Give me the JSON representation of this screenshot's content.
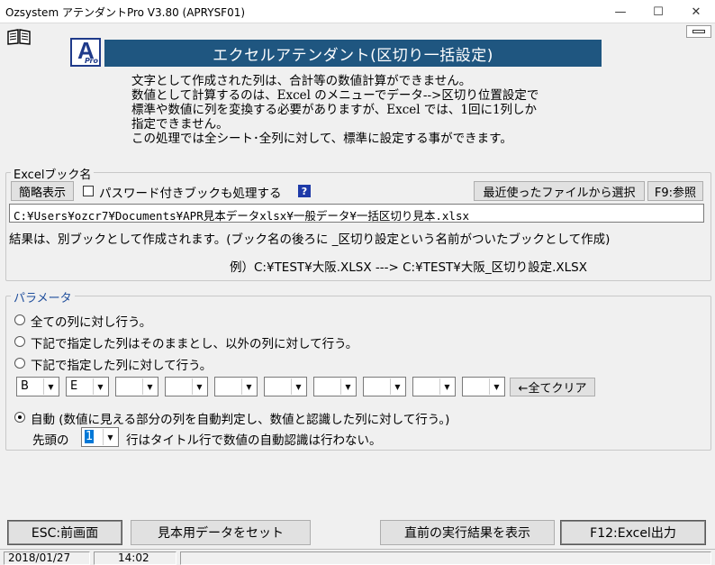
{
  "window": {
    "title": "Ozsystem アテンダントPro V3.80 (APRYSF01)",
    "minimize_glyph": "—",
    "maximize_glyph": "☐",
    "close_glyph": "✕"
  },
  "header": {
    "logo_letter": "A",
    "logo_sub": "Pro",
    "banner_title": "エクセルアテンダント(区切り一括設定)",
    "book_icon": "book-icon"
  },
  "description": {
    "lines": [
      "文字として作成された列は、合計等の数値計算ができません。",
      "数値として計算するのは、Excel のメニューでデータ-->区切り位置設定で",
      "標準や数値に列を変換する必要がありますが、Excel では、1回に1列しか",
      "指定できません。",
      "この処理では全シート･全列に対して、標準に設定する事ができます。"
    ]
  },
  "book_group": {
    "legend": "Excelブック名",
    "short_display_button": "簡略表示",
    "password_checkbox_label": "パスワード付きブックも処理する",
    "password_checked": false,
    "help_badge": "?",
    "recent_files_button": "最近使ったファイルから選択",
    "browse_button": "F9:参照",
    "path_value": "C:¥Users¥ozcr7¥Documents¥APR見本データxlsx¥一般データ¥一括区切り見本.xlsx",
    "result_note": "結果は、別ブックとして作成されます。(ブック名の後ろに _区切り設定という名前がついたブックとして作成)",
    "example": "例）C:¥TEST¥大阪.XLSX ---> C:¥TEST¥大阪_区切り設定.XLSX"
  },
  "params_group": {
    "legend": "パラメータ",
    "options": [
      "全ての列に対し行う。",
      "下記で指定した列はそのままとし、以外の列に対して行う。",
      "下記で指定した列に対して行う。"
    ],
    "columns": [
      "B",
      "E",
      "",
      "",
      "",
      "",
      "",
      "",
      "",
      ""
    ],
    "clear_all_button": "←全てクリア",
    "auto_option": "自動 (数値に見える部分の列を自動判定し、数値と認識した列に対して行う。)",
    "selected_option": "auto",
    "header_prefix": "先頭の",
    "header_rows_value": "1",
    "header_suffix": "行はタイトル行で数値の自動認識は行わない。"
  },
  "footer": {
    "esc_button": "ESC:前画面",
    "sample_button": "見本用データをセット",
    "last_result_button": "直前の実行結果を表示",
    "output_button": "F12:Excel出力"
  },
  "status": {
    "date": "2018/01/27",
    "time": "14:02"
  },
  "colors": {
    "banner": "#1f5680",
    "logo": "#1f3a8a",
    "help_badge": "#1e3aa8"
  }
}
